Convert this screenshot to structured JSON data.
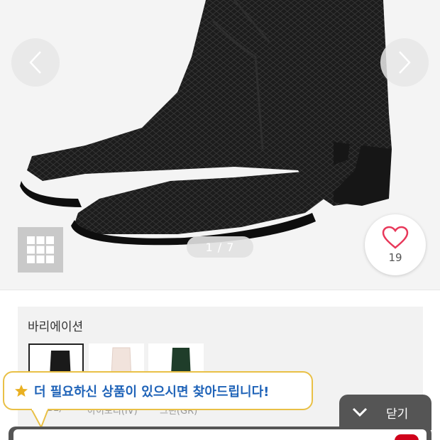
{
  "gallery": {
    "pager": "1 / 7",
    "prev_icon": "chevron-left-icon",
    "next_icon": "chevron-right-icon",
    "grid_icon": "grid-icon",
    "like_icon": "heart-icon",
    "like_count": "19"
  },
  "variation": {
    "title": "바리에이션",
    "swatches": [
      {
        "label": "(BL)",
        "color": "#1a1a1a",
        "selected": true
      },
      {
        "label": "아이보리(IV)",
        "color": "#f1e3dc",
        "selected": false
      },
      {
        "label": "그린(GR)",
        "color": "#1f3d2a",
        "selected": false
      }
    ]
  },
  "promo": {
    "icon": "star-icon",
    "text": "더 필요하신 상품이 있으시면 찾아드립니다!"
  },
  "close_tab": {
    "icon": "chevron-down-icon",
    "label": "닫기"
  },
  "colors": {
    "accent_blue": "#1f63b8",
    "bubble_border": "#e9c046",
    "heart": "#e8385a",
    "tab_bg": "#555555",
    "badge_red": "#d0021b"
  }
}
